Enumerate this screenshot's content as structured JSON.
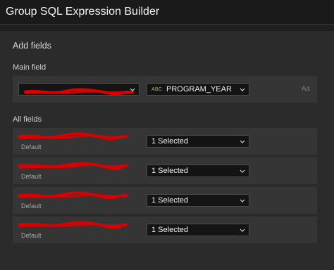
{
  "window": {
    "title": "Group SQL Expression Builder"
  },
  "sections": {
    "add_fields": "Add fields",
    "main_field": "Main field",
    "all_fields": "All fields"
  },
  "main_field": {
    "left_select": {
      "value": ""
    },
    "right_select": {
      "type_tag": "ABC",
      "value": "PROGRAM_YEAR"
    },
    "format_hint": "Aa"
  },
  "all_fields": {
    "rows": [
      {
        "sub_label": "Default",
        "select_value": "1 Selected"
      },
      {
        "sub_label": "Default",
        "select_value": "1 Selected"
      },
      {
        "sub_label": "Default",
        "select_value": "1 Selected"
      },
      {
        "sub_label": "Default",
        "select_value": "1 Selected"
      }
    ]
  },
  "colors": {
    "redaction": "#d80000",
    "panel": "#2b2b2b",
    "row": "#353535",
    "input_bg": "#141414"
  },
  "icons": {
    "chevron": "chevron-down-icon"
  }
}
